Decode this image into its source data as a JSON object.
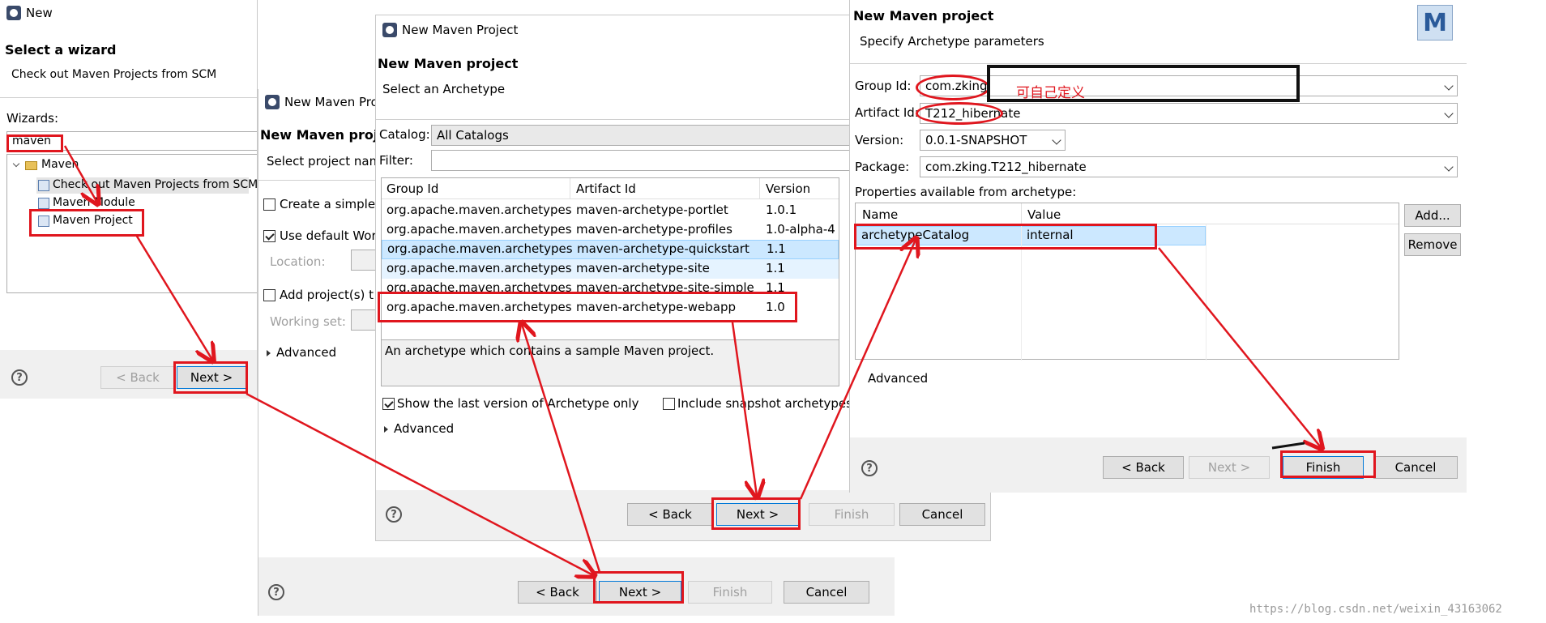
{
  "dialog1": {
    "title": "New",
    "header_title": "Select a wizard",
    "header_subtitle": "Check out Maven Projects from SCM",
    "wizards_label": "Wizards:",
    "filter_value": "maven",
    "tree": {
      "folder": "Maven",
      "items": [
        "Check out Maven Projects from SCM",
        "Maven Module",
        "Maven Project"
      ]
    },
    "back_label": "< Back",
    "next_label": "Next >"
  },
  "dialog2": {
    "title": "New Maven Pro",
    "header_title": "New Maven proje",
    "header_subtitle": "Select project nam",
    "create_simple": "Create a simple",
    "use_default": "Use default Wor",
    "location_label": "Location:",
    "add_project": "Add project(s) t",
    "working_set_label": "Working set:",
    "advanced": "Advanced",
    "back_label": "< Back",
    "next_label": "Next >",
    "finish_label": "Finish",
    "cancel_label": "Cancel"
  },
  "dialog3": {
    "title": "New Maven Project",
    "header_title": "New Maven project",
    "header_subtitle": "Select an Archetype",
    "catalog_label": "Catalog:",
    "catalog_value": "All Catalogs",
    "filter_label": "Filter:",
    "columns": [
      "Group Id",
      "Artifact Id",
      "Version"
    ],
    "rows": [
      [
        "org.apache.maven.archetypes",
        "maven-archetype-portlet",
        "1.0.1"
      ],
      [
        "org.apache.maven.archetypes",
        "maven-archetype-profiles",
        "1.0-alpha-4"
      ],
      [
        "org.apache.maven.archetypes",
        "maven-archetype-quickstart",
        "1.1"
      ],
      [
        "org.apache.maven.archetypes",
        "maven-archetype-site",
        "1.1"
      ],
      [
        "org.apache.maven.archetypes",
        "maven-archetype-site-simple",
        "1.1"
      ],
      [
        "org.apache.maven.archetypes",
        "maven-archetype-webapp",
        "1.0"
      ]
    ],
    "description": "An archetype which contains a sample Maven project.",
    "show_last_version": "Show the last version of Archetype only",
    "include_snapshot": "Include snapshot archetypes",
    "advanced": "Advanced",
    "back_label": "< Back",
    "next_label": "Next >",
    "finish_label": "Finish",
    "cancel_label": "Cancel"
  },
  "dialog4": {
    "header_title": "New Maven project",
    "header_subtitle": "Specify Archetype parameters",
    "group_id_label": "Group Id:",
    "group_id_value": "com.zking",
    "artifact_id_label": "Artifact Id:",
    "artifact_id_value": "T212_hibernate",
    "version_label": "Version:",
    "version_value": "0.0.1-SNAPSHOT",
    "package_label": "Package:",
    "package_value": "com.zking.T212_hibernate",
    "properties_label": "Properties available from archetype:",
    "columns": [
      "Name",
      "Value"
    ],
    "properties": [
      [
        "archetypeCatalog",
        "internal"
      ]
    ],
    "add_label": "Add...",
    "remove_label": "Remove",
    "advanced": "Advanced",
    "back_label": "< Back",
    "next_label": "Next >",
    "finish_label": "Finish",
    "cancel_label": "Cancel"
  },
  "annotation_text": "可自己定义",
  "watermark": "https://blog.csdn.net/weixin_43163062",
  "colors": {
    "annotation": "#e0161e",
    "selection": "#cce8ff"
  }
}
